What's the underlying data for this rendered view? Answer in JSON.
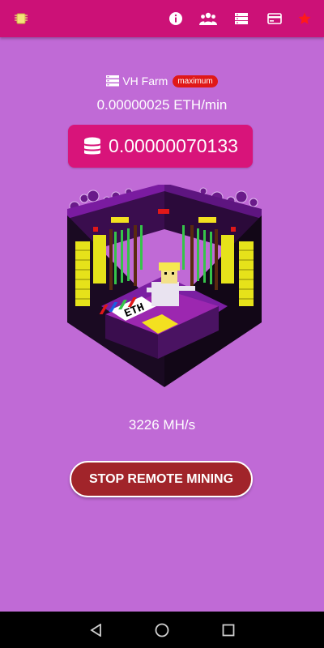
{
  "topbar": {
    "color": "#cc1177",
    "icons": [
      "chip-icon",
      "info-icon",
      "group-icon",
      "server-icon",
      "card-icon",
      "star-icon"
    ]
  },
  "farm": {
    "icon": "server-list-icon",
    "name": "VH Farm",
    "badge": "maximum"
  },
  "mining": {
    "rate": "0.00000025 ETH/min",
    "balance": "0.00000070133",
    "balance_icon": "coins-icon",
    "coin_label": "ETH",
    "hashrate": "3226 MH/s"
  },
  "actions": {
    "stop_label": "STOP REMOTE MINING"
  },
  "navbar": {
    "icons": [
      "back-icon",
      "home-icon",
      "recents-icon"
    ]
  },
  "colors": {
    "background": "#c06ad6",
    "accent": "#d8147a",
    "button": "#a1242a"
  }
}
